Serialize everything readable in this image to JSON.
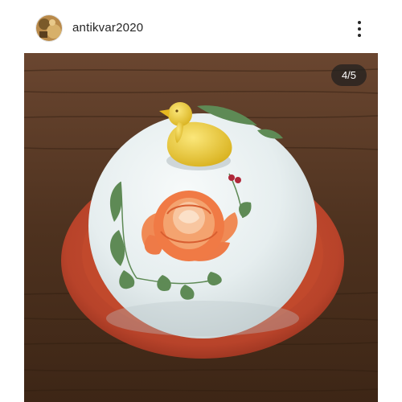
{
  "post": {
    "username": "antikvar2020",
    "more_icon": "more-vertical-icon",
    "avatar_icon": "profile-avatar"
  },
  "media": {
    "counter": "4/5",
    "subject": "porcelain-butter-dish-photo"
  },
  "colors": {
    "username": "#262626",
    "counter_bg": "#1e1e1e",
    "plate": "#c24a2c",
    "dome": "#e9eff0",
    "duck": "#f2d43a",
    "rose": "#f07a45",
    "wood": "#5a3a24"
  }
}
